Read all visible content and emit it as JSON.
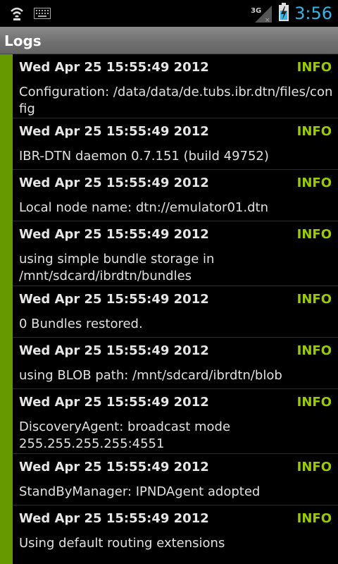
{
  "status_bar": {
    "clock": "3:56",
    "network_type": "3G",
    "icons": [
      "wifi-icon",
      "keyboard-icon",
      "signal-icon",
      "battery-charging-icon"
    ]
  },
  "title_bar": {
    "title": "Logs"
  },
  "colors": {
    "level_info": "#99cc00",
    "row_marker": "#669900",
    "clock": "#33b5e5"
  },
  "logs": [
    {
      "date": "Wed Apr 25 15:55:49 2012",
      "level": "INFO",
      "message": "Configuration: /data/data/de.tubs.ibr.dtn/files/config"
    },
    {
      "date": "Wed Apr 25 15:55:49 2012",
      "level": "INFO",
      "message": "IBR-DTN daemon 0.7.151 (build 49752)"
    },
    {
      "date": "Wed Apr 25 15:55:49 2012",
      "level": "INFO",
      "message": "Local node name: dtn://emulator01.dtn"
    },
    {
      "date": "Wed Apr 25 15:55:49 2012",
      "level": "INFO",
      "message": "using simple bundle storage in /mnt/sdcard/ibrdtn/bundles"
    },
    {
      "date": "Wed Apr 25 15:55:49 2012",
      "level": "INFO",
      "message": "0 Bundles restored."
    },
    {
      "date": "Wed Apr 25 15:55:49 2012",
      "level": "INFO",
      "message": "using BLOB path: /mnt/sdcard/ibrdtn/blob"
    },
    {
      "date": "Wed Apr 25 15:55:49 2012",
      "level": "INFO",
      "message": "DiscoveryAgent: broadcast mode 255.255.255.255:4551"
    },
    {
      "date": "Wed Apr 25 15:55:49 2012",
      "level": "INFO",
      "message": "StandByManager: IPNDAgent adopted"
    },
    {
      "date": "Wed Apr 25 15:55:49 2012",
      "level": "INFO",
      "message": "Using default routing extensions"
    }
  ]
}
